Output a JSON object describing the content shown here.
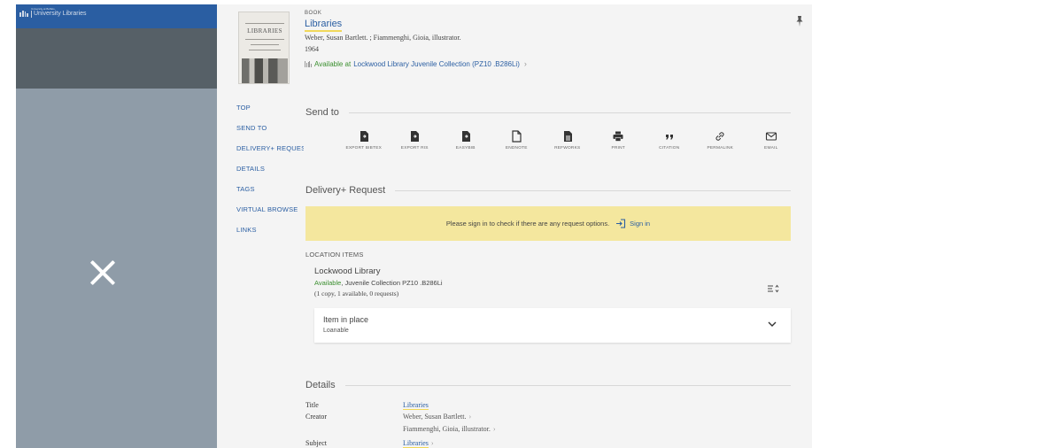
{
  "overlay": {
    "logo_small": "University at Buffalo",
    "logo_big": "University Libraries"
  },
  "record": {
    "thumbnail_title": "LIBRARIES",
    "type_label": "BOOK",
    "title": "Libraries",
    "authors": "Weber, Susan Bartlett. ; Fiammenghi, Gioia, illustrator.",
    "year": "1964",
    "availability_status": "Available at",
    "availability_location": "Lockwood Library  Juvenile Collection (PZ10 .B286Li)"
  },
  "side_nav": [
    "TOP",
    "SEND TO",
    "DELIVERY+ REQUEST",
    "DETAILS",
    "TAGS",
    "VIRTUAL BROWSE",
    "LINKS"
  ],
  "send_to": {
    "heading": "Send to",
    "items": [
      {
        "label": "EXPORT BIBTEX",
        "icon": "file-export-icon"
      },
      {
        "label": "EXPORT RIS",
        "icon": "file-export-icon"
      },
      {
        "label": "EASYBIB",
        "icon": "file-export-icon"
      },
      {
        "label": "ENDNOTE",
        "icon": "document-outline-icon"
      },
      {
        "label": "REFWORKS",
        "icon": "document-lines-icon"
      },
      {
        "label": "PRINT",
        "icon": "printer-icon"
      },
      {
        "label": "CITATION",
        "icon": "quote-icon"
      },
      {
        "label": "PERMALINK",
        "icon": "link-icon"
      },
      {
        "label": "EMAIL",
        "icon": "envelope-icon"
      }
    ]
  },
  "delivery": {
    "heading": "Delivery+ Request",
    "signin_message": "Please sign in to check if there are any request options.",
    "signin_link": "Sign in",
    "location_items_label": "LOCATION ITEMS",
    "location_name": "Lockwood Library",
    "location_status": "Available",
    "location_detail": ", Juvenile Collection PZ10 .B286Li",
    "location_copies": "(1 copy, 1 available, 0 requests)",
    "item_title": "Item in place",
    "item_policy": "Loanable"
  },
  "details": {
    "heading": "Details",
    "title_key": "Title",
    "title_value": "Libraries",
    "creator_key": "Creator",
    "creator_1": "Weber, Susan Bartlett.",
    "creator_2": "Fiammenghi, Gioia, illustrator.",
    "subject_key": "Subject",
    "subject_value": "Libraries"
  },
  "colors": {
    "link": "#2a5ea2",
    "available": "#3b8f2f",
    "banner": "#f4e79e",
    "overlay": "#8f9ca8"
  }
}
